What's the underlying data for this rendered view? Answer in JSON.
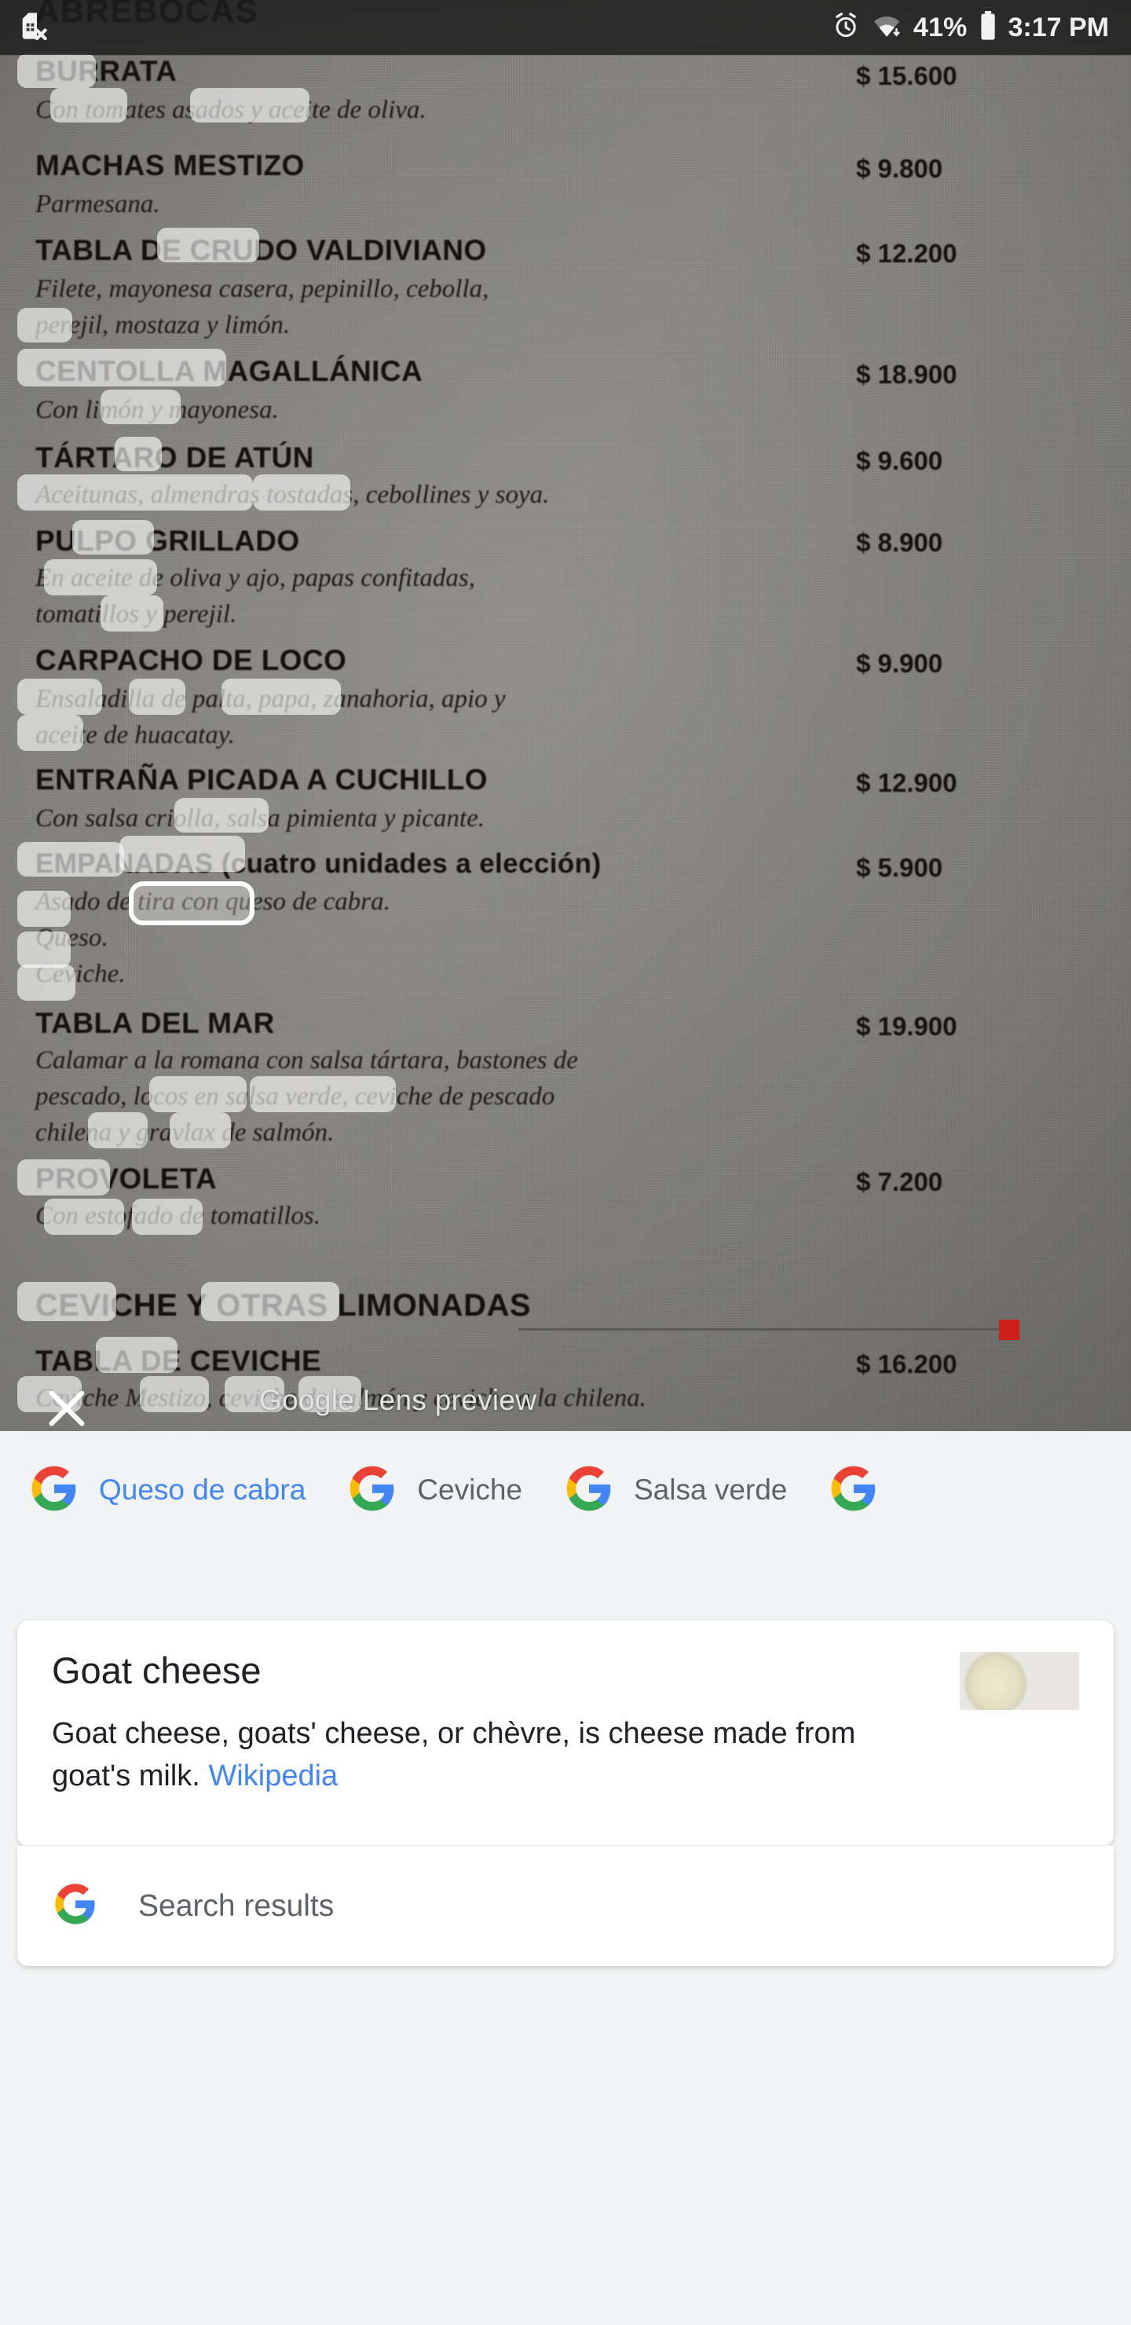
{
  "status_bar": {
    "no_sim_icon": "sim-card-off-icon",
    "alarm_icon": "alarm-icon",
    "wifi_icon": "wifi-icon",
    "battery_percent": "41%",
    "battery_icon": "battery-icon",
    "time": "3:17 PM"
  },
  "viewfinder": {
    "section_header": "ABREBOCAS",
    "lens_preview_label": "Google Lens preview",
    "close_icon": "close-icon",
    "selected_text": "queso de cabra.",
    "menu_items": [
      {
        "title": "BURRATA",
        "desc1": "Con tomates asados y aceite de oliva.",
        "desc2": "",
        "price": "$  15.600"
      },
      {
        "title": "MACHAS MESTIZO",
        "desc1": "Parmesana.",
        "desc2": "",
        "price": "$   9.800"
      },
      {
        "title": "TABLA DE CRUDO VALDIVIANO",
        "desc1": "Filete, mayonesa casera, pepinillo, cebolla,",
        "desc2": "perejil, mostaza y limón.",
        "price": "$  12.200"
      },
      {
        "title": "CENTOLLA MAGALLÁNICA",
        "desc1": "Con limón y mayonesa.",
        "desc2": "",
        "price": "$  18.900"
      },
      {
        "title": "TÁRTARO DE ATÚN",
        "desc1": "Aceitunas, almendras tostadas, cebollines y soya.",
        "desc2": "",
        "price": "$   9.600"
      },
      {
        "title": "PULPO GRILLADO",
        "desc1": "En aceite de oliva y ajo, papas confitadas,",
        "desc2": "tomatillos y perejil.",
        "price": "$   8.900"
      },
      {
        "title": "CARPACHO DE LOCO",
        "desc1": "Ensaladilla de palta, papa, zanahoria, apio y",
        "desc2": "aceite de huacatay.",
        "price": "$   9.900"
      },
      {
        "title": "ENTRAÑA PICADA A CUCHILLO",
        "desc1": "Con salsa criolla, salsa pimienta y picante.",
        "desc2": "",
        "price": "$  12.900"
      },
      {
        "title": "EMPANADAS  (cuatro unidades a elección)",
        "desc1": "Asado de tira con queso de cabra.",
        "desc2": "Queso.",
        "desc3": "Ceviche.",
        "price": "$   5.900"
      },
      {
        "title": "TABLA DEL MAR",
        "desc1": "Calamar a la romana con salsa tártara, bastones de",
        "desc2": "pescado, locos en salsa verde, ceviche de pescado",
        "desc3": "chilena y gravlax de salmón.",
        "price": "$  19.900"
      },
      {
        "title": "PROVOLETA",
        "desc1": "Con estofado de tomatillos.",
        "desc2": "",
        "price": "$   7.200"
      },
      {
        "title": "CEVICHE Y OTRAS LIMONADAS",
        "desc1": "",
        "desc2": "",
        "price": ""
      },
      {
        "title": "TABLA DE CEVICHE",
        "desc1": "Ceviche Mestizo, ceviche de salmón y ceviche a la chilena.",
        "desc2": "",
        "price": "$  16.200"
      }
    ]
  },
  "sheet": {
    "chips": [
      {
        "label": "Queso de cabra",
        "icon": "google-logo-icon",
        "active": true
      },
      {
        "label": "Ceviche",
        "icon": "google-logo-icon",
        "active": false
      },
      {
        "label": "Salsa verde",
        "icon": "google-logo-icon",
        "active": false
      },
      {
        "label": "",
        "icon": "google-logo-icon",
        "active": false
      }
    ],
    "card": {
      "title": "Goat cheese",
      "description_part1": "Goat cheese, goats' cheese, or chèvre, is cheese made from goat's milk. ",
      "source_link": "Wikipedia",
      "thumbnail_icon": "goat-cheese-thumbnail"
    },
    "search_results": {
      "label": "Search results",
      "icon": "google-logo-icon"
    }
  },
  "colors": {
    "google_blue": "#4285f4",
    "google_red": "#ea4335",
    "google_yellow": "#fbbc05",
    "google_green": "#34a853",
    "sheet_bg": "#f1f3f4",
    "text_primary": "#202124",
    "text_secondary": "#5f6368",
    "marker_red": "#cc2018"
  }
}
